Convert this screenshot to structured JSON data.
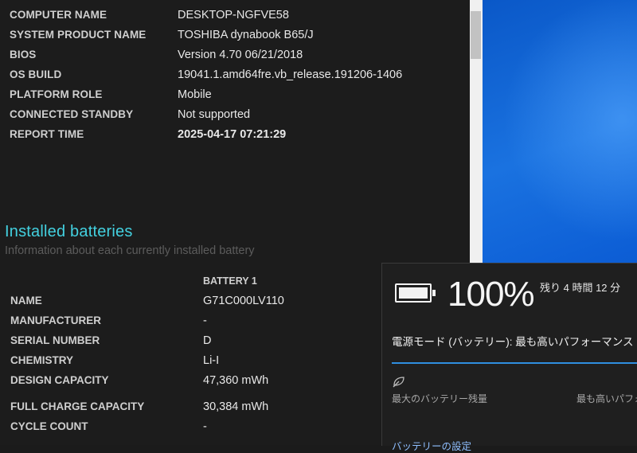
{
  "system_info": [
    {
      "key": "COMPUTER NAME",
      "value": "DESKTOP-NGFVE58"
    },
    {
      "key": "SYSTEM PRODUCT NAME",
      "value": "TOSHIBA dynabook B65/J"
    },
    {
      "key": "BIOS",
      "value": "Version 4.70 06/21/2018"
    },
    {
      "key": "OS BUILD",
      "value": "19041.1.amd64fre.vb_release.191206-1406"
    },
    {
      "key": "PLATFORM ROLE",
      "value": "Mobile"
    },
    {
      "key": "CONNECTED STANDBY",
      "value": "Not supported"
    },
    {
      "key": "REPORT TIME",
      "value": "2025-04-17  07:21:29"
    }
  ],
  "installed_batteries": {
    "title": "Installed batteries",
    "subtitle": "Information about each currently installed battery",
    "column_header": "BATTERY 1",
    "rows": [
      {
        "key": "NAME",
        "value": "G71C000LV110"
      },
      {
        "key": "MANUFACTURER",
        "value": "-"
      },
      {
        "key": "SERIAL NUMBER",
        "value": "D"
      },
      {
        "key": "CHEMISTRY",
        "value": "Li-I"
      },
      {
        "key": "DESIGN CAPACITY",
        "value": "47,360 mWh"
      },
      {
        "key": "FULL CHARGE CAPACITY",
        "value": "30,384 mWh"
      },
      {
        "key": "CYCLE COUNT",
        "value": "-"
      }
    ]
  },
  "battery_flyout": {
    "percent": "100%",
    "remaining": "残り 4 時間 12 分",
    "power_mode": "電源モード (バッテリー): 最も高いパフォーマンス",
    "slider_left_label": "最大のバッテリー残量",
    "slider_right_label": "最も高いパフォ",
    "settings_link": "バッテリーの設定",
    "accent_color": "#2f8fe0"
  },
  "icons": {
    "battery": "battery-full-icon",
    "leaf": "battery-saver-leaf-icon"
  }
}
